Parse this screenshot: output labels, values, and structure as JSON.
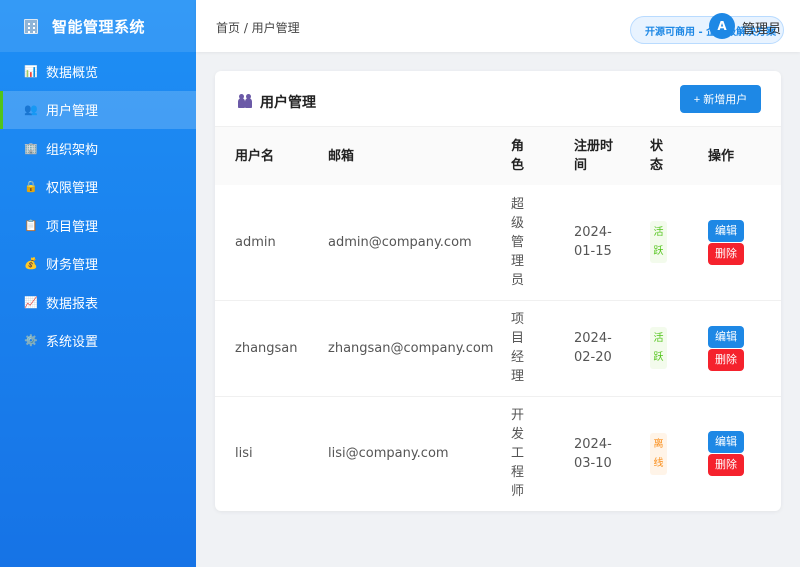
{
  "brand": {
    "title": "智能管理系统",
    "icon": "building-icon"
  },
  "sidebar": {
    "items": [
      {
        "label": "数据概览",
        "icon": "chart-icon"
      },
      {
        "label": "用户管理",
        "icon": "users-icon",
        "active": true
      },
      {
        "label": "组织架构",
        "icon": "building-icon"
      },
      {
        "label": "权限管理",
        "icon": "lock-icon"
      },
      {
        "label": "项目管理",
        "icon": "clipboard-icon"
      },
      {
        "label": "财务管理",
        "icon": "money-bag-icon"
      },
      {
        "label": "数据报表",
        "icon": "trend-icon"
      },
      {
        "label": "系统设置",
        "icon": "gear-icon"
      }
    ]
  },
  "header": {
    "breadcrumb": "首页 / 用户管理",
    "promo": "开源可商用 - 企业级解决方案",
    "avatar": "A",
    "username": "管理员"
  },
  "card": {
    "title": "用户管理",
    "add_button": "+ 新增用户"
  },
  "table": {
    "headers": [
      "用户名",
      "邮箱",
      "角色",
      "注册时间",
      "状态",
      "操作"
    ],
    "rows": [
      {
        "username": "admin",
        "email": "admin@company.com",
        "role": "超级管理员",
        "date": "2024-01-15",
        "status": "活跃",
        "edit": "编辑",
        "delete": "删除"
      },
      {
        "username": "zhangsan",
        "email": "zhangsan@company.com",
        "role": "项目经理",
        "date": "2024-02-20",
        "status": "活跃",
        "edit": "编辑",
        "delete": "删除"
      },
      {
        "username": "lisi",
        "email": "lisi@company.com",
        "role": "开发工程师",
        "date": "2024-03-10",
        "status": "离线",
        "edit": "编辑",
        "delete": "删除"
      }
    ]
  },
  "colors": {
    "primary": "#1e88e5",
    "danger": "#f5222d",
    "success": "#52c41a",
    "warning": "#fa8c16",
    "sidebar": "#1e8ff5"
  }
}
